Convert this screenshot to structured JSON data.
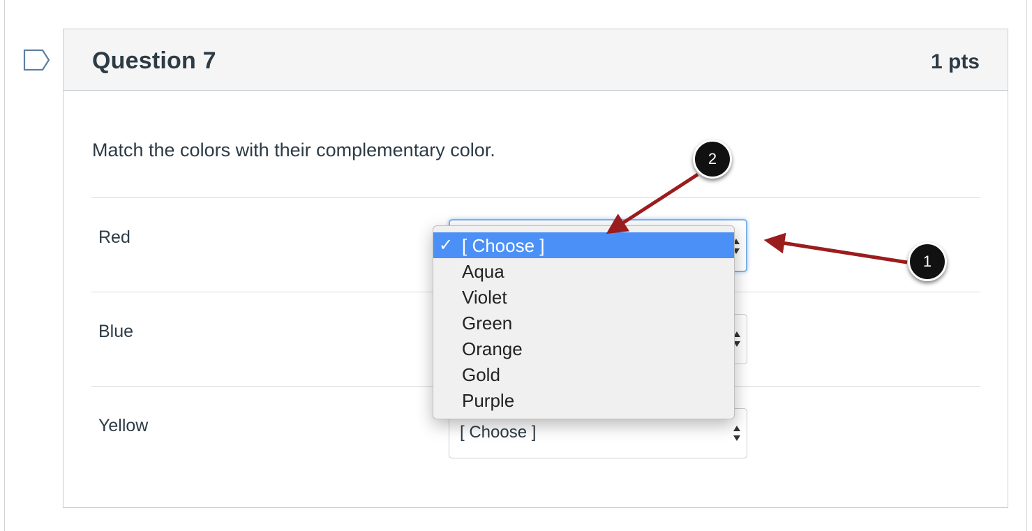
{
  "question": {
    "title": "Question 7",
    "points": "1 pts",
    "text": "Match the colors with their complementary color."
  },
  "rows": [
    {
      "label": "Red"
    },
    {
      "label": "Blue"
    },
    {
      "label": "Yellow",
      "selected_value": "[ Choose ]"
    }
  ],
  "dropdown": {
    "options": [
      "[ Choose ]",
      "Aqua",
      "Violet",
      "Green",
      "Orange",
      "Gold",
      "Purple"
    ],
    "selected_index": 0,
    "checkmark": "✓"
  },
  "callouts": {
    "one": "1",
    "two": "2"
  },
  "colors": {
    "annotation_arrow": "#9b1c1c",
    "selection_highlight": "#4a90f7",
    "focus_ring": "#7fb3ea"
  },
  "icons": [
    "flag-icon",
    "select-arrows-icon",
    "checkmark-icon"
  ]
}
